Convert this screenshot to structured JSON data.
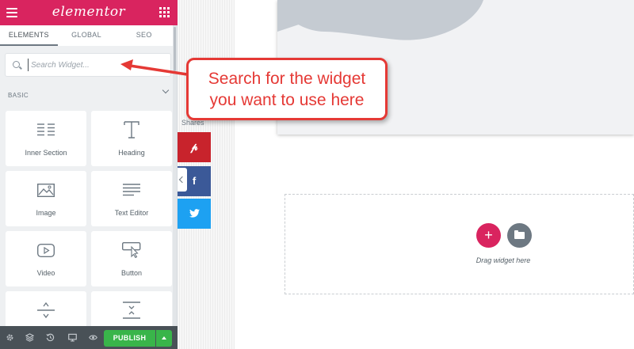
{
  "app": {
    "logo": "elementor"
  },
  "tabs": [
    {
      "label": "ELEMENTS",
      "active": true
    },
    {
      "label": "GLOBAL",
      "active": false
    },
    {
      "label": "SEO",
      "active": false
    }
  ],
  "search": {
    "placeholder": "Search Widget..."
  },
  "section": {
    "label": "BASIC"
  },
  "widgets": [
    {
      "label": "Inner Section",
      "icon": "inner-section-icon"
    },
    {
      "label": "Heading",
      "icon": "heading-icon"
    },
    {
      "label": "Image",
      "icon": "image-icon"
    },
    {
      "label": "Text Editor",
      "icon": "text-editor-icon"
    },
    {
      "label": "Video",
      "icon": "video-icon"
    },
    {
      "label": "Button",
      "icon": "button-icon"
    },
    {
      "label": "",
      "icon": "divider-icon"
    },
    {
      "label": "",
      "icon": "spacer-icon"
    }
  ],
  "footer": {
    "publish_label": "PUBLISH"
  },
  "share": {
    "label": "Shares",
    "networks": [
      "pinterest",
      "facebook",
      "twitter"
    ]
  },
  "canvas": {
    "drop_text": "Drag widget here"
  },
  "callout": {
    "line1": "Search for the widget",
    "line2": "you want to use here",
    "color": "#e53935"
  },
  "colors": {
    "brand": "#d9245f",
    "publish": "#39b54a",
    "pinterest": "#c8232c",
    "facebook": "#3b5998",
    "twitter": "#1da1f2"
  }
}
